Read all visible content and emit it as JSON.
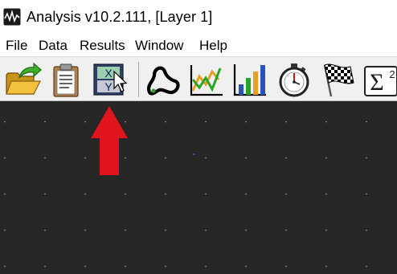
{
  "window": {
    "title": "Analysis v10.2.111, [Layer 1]"
  },
  "menu": [
    {
      "label": "File"
    },
    {
      "label": "Data"
    },
    {
      "label": "Results"
    },
    {
      "label": "Window"
    },
    {
      "label": "Help"
    }
  ],
  "toolbar": {
    "buttons": [
      {
        "icon": "open-folder-icon"
      },
      {
        "icon": "clipboard-icon"
      },
      {
        "icon": "xy-data-icon",
        "letters": [
          "X",
          "Y"
        ]
      },
      {
        "icon": "track-curve-icon"
      },
      {
        "icon": "line-chart-icon"
      },
      {
        "icon": "bar-chart-icon"
      },
      {
        "icon": "stopwatch-icon"
      },
      {
        "icon": "checkered-flag-icon"
      },
      {
        "icon": "sigma-math-icon",
        "letters": [
          "Σ",
          "2"
        ]
      }
    ]
  },
  "colors": {
    "canvas_bg": "#262626",
    "toolbar_bg": "#f0f0f0",
    "annotation_arrow": "#e0141c"
  }
}
